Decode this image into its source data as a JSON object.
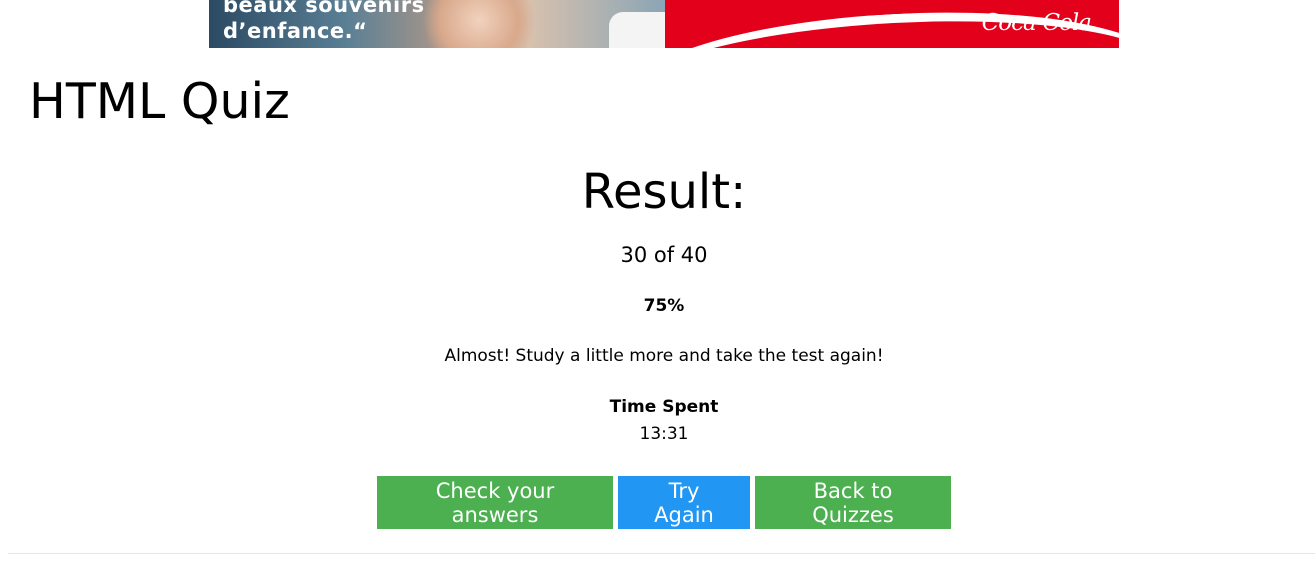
{
  "ad": {
    "text_line1": "beaux souvenirs",
    "text_line2": "d’enfance.“",
    "brand_logo": "Coca-Cola",
    "colors": {
      "brand_red": "#e2001a"
    }
  },
  "page": {
    "title": "HTML Quiz"
  },
  "result": {
    "heading": "Result:",
    "score": "30 of 40",
    "percent": "75%",
    "message": "Almost! Study a little more and take the test again!",
    "time_label": "Time Spent",
    "time_value": "13:31"
  },
  "buttons": {
    "check_answers": "Check your answers",
    "try_again": "Try Again",
    "back_to_quizzes": "Back to Quizzes"
  },
  "colors": {
    "green": "#4caf50",
    "blue": "#2196f3"
  }
}
